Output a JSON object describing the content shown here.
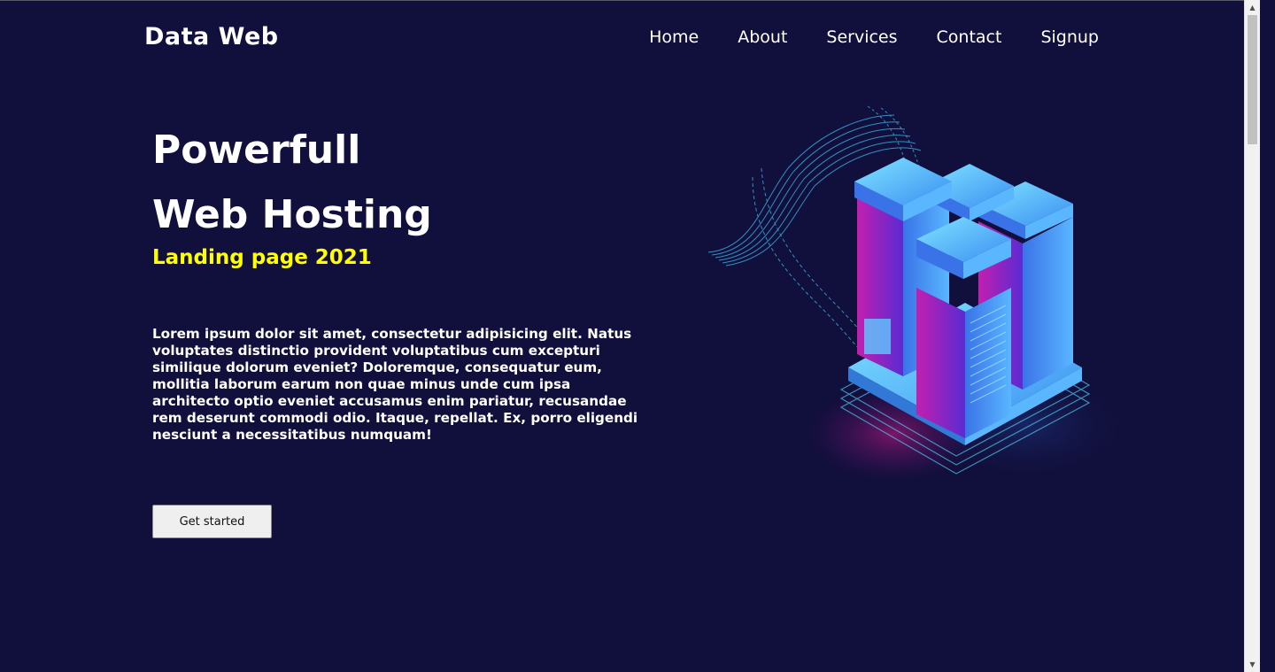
{
  "header": {
    "logo": "Data Web",
    "nav": [
      "Home",
      "About",
      "Services",
      "Contact",
      "Signup"
    ]
  },
  "hero": {
    "title_line1": "Powerfull",
    "title_line2": "Web Hosting",
    "subtitle": "Landing page 2021",
    "description": "Lorem ipsum dolor sit amet, consectetur adipisicing elit. Natus voluptates distinctio provident voluptatibus cum excepturi similique dolorum eveniet? Doloremque, consequatur eum, mollitia laborum earum non quae minus unde cum ipsa architecto optio eveniet accusamus enim pariatur, recusandae rem deserunt commodi odio. Itaque, repellat. Ex, porro eligendi nesciunt a necessitatibus numquam!",
    "cta_label": "Get started"
  },
  "colors": {
    "background": "#110f3b",
    "accent_yellow": "#ffff00",
    "text": "#ffffff"
  },
  "icons": {
    "scroll_up": "triangle-up-icon",
    "scroll_down": "triangle-down-icon"
  }
}
